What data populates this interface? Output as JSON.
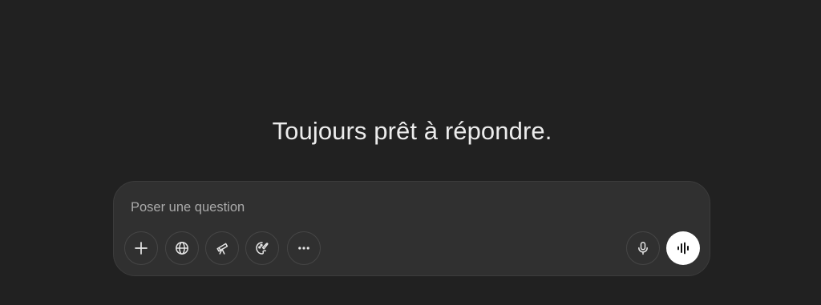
{
  "hero": {
    "title": "Toujours prêt à répondre."
  },
  "composer": {
    "placeholder": "Poser une question",
    "tools": [
      {
        "name": "add",
        "icon": "plus-icon"
      },
      {
        "name": "web-search",
        "icon": "globe-icon"
      },
      {
        "name": "deep-research",
        "icon": "telescope-icon"
      },
      {
        "name": "create-image",
        "icon": "palette-icon"
      },
      {
        "name": "more",
        "icon": "more-horizontal-icon"
      }
    ],
    "dictate": {
      "icon": "microphone-icon"
    },
    "voice_mode": {
      "icon": "voice-waveform-icon"
    }
  },
  "colors": {
    "background": "#212121",
    "composer_background": "#303030",
    "composer_border": "#3c3c3c",
    "text_primary": "#ececec",
    "placeholder": "#a9a9a9",
    "voice_button": "#ffffff"
  }
}
